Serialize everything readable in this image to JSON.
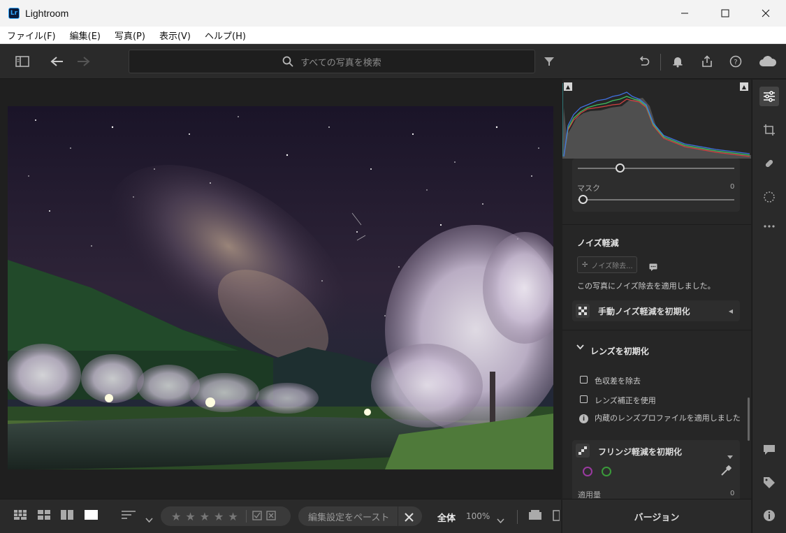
{
  "window": {
    "title": "Lightroom",
    "logo": "Lr"
  },
  "menu": [
    "ファイル(F)",
    "編集(E)",
    "写真(P)",
    "表示(V)",
    "ヘルプ(H)"
  ],
  "search": {
    "placeholder": "すべての写真を検索"
  },
  "panel": {
    "mask_label": "マスク",
    "mask_value": "0",
    "noise_title": "ノイズ軽減",
    "denoise_button": "ノイズ除去...",
    "denoise_applied": "この写真にノイズ除去を適用しました。",
    "manual_noise_reset": "手動ノイズ軽減を初期化",
    "lens_title": "レンズを初期化",
    "remove_ca": "色収差を除去",
    "lens_correction": "レンズ補正を使用",
    "lens_profile_info": "内蔵のレンズプロファイルを適用しました",
    "fringe_reset": "フリンジ軽減を初期化",
    "amount_label": "適用量",
    "amount_value": "0"
  },
  "bottombar": {
    "stars": [
      "★",
      "★",
      "★",
      "★",
      "★"
    ],
    "paste_label": "編集設定をペースト",
    "zoom_fit": "全体",
    "zoom_pct": "100%"
  },
  "version_label": "バージョン",
  "colors": {
    "accent": "#31a8ff",
    "panel_bg": "#262626",
    "toolbar_bg": "#2a2a2a"
  }
}
